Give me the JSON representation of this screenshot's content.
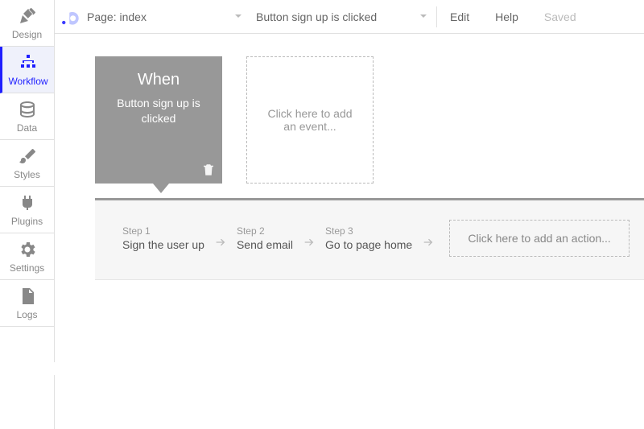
{
  "logo_label": "bubble",
  "topbar": {
    "page_dropdown": "Page: index",
    "event_dropdown": "Button sign up is clicked",
    "links": {
      "edit": "Edit",
      "help": "Help",
      "saved": "Saved"
    }
  },
  "sidebar": {
    "items": [
      {
        "name": "design",
        "label": "Design"
      },
      {
        "name": "workflow",
        "label": "Workflow"
      },
      {
        "name": "data",
        "label": "Data"
      },
      {
        "name": "styles",
        "label": "Styles"
      },
      {
        "name": "plugins",
        "label": "Plugins"
      },
      {
        "name": "settings",
        "label": "Settings"
      },
      {
        "name": "logs",
        "label": "Logs"
      }
    ]
  },
  "workspace": {
    "event_card": {
      "title": "When",
      "desc": "Button sign up is clicked"
    },
    "event_placeholder": "Click here to add an event...",
    "actions": [
      {
        "num": "Step 1",
        "name": "Sign the user up"
      },
      {
        "num": "Step 2",
        "name": "Send email"
      },
      {
        "num": "Step 3",
        "name": "Go to page home"
      }
    ],
    "action_placeholder": "Click here to add an action..."
  }
}
